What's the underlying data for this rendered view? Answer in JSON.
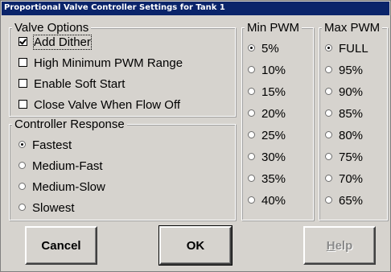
{
  "window": {
    "title": "Proportional Valve Controller Settings for Tank 1"
  },
  "valve_options": {
    "legend": "Valve Options",
    "items": [
      {
        "label": "Add Dither",
        "checked": true
      },
      {
        "label": "High Minimum PWM Range",
        "checked": false
      },
      {
        "label": "Enable Soft Start",
        "checked": false
      },
      {
        "label": "Close Valve When Flow Off",
        "checked": false
      }
    ]
  },
  "controller_response": {
    "legend": "Controller Response",
    "options": [
      {
        "label": "Fastest",
        "selected": true
      },
      {
        "label": "Medium-Fast",
        "selected": false
      },
      {
        "label": "Medium-Slow",
        "selected": false
      },
      {
        "label": "Slowest",
        "selected": false
      }
    ]
  },
  "min_pwm": {
    "legend": "Min PWM",
    "options": [
      {
        "label": "5%",
        "selected": true
      },
      {
        "label": "10%",
        "selected": false
      },
      {
        "label": "15%",
        "selected": false
      },
      {
        "label": "20%",
        "selected": false
      },
      {
        "label": "25%",
        "selected": false
      },
      {
        "label": "30%",
        "selected": false
      },
      {
        "label": "35%",
        "selected": false
      },
      {
        "label": "40%",
        "selected": false
      }
    ]
  },
  "max_pwm": {
    "legend": "Max PWM",
    "options": [
      {
        "label": "FULL",
        "selected": true
      },
      {
        "label": "95%",
        "selected": false
      },
      {
        "label": "90%",
        "selected": false
      },
      {
        "label": "85%",
        "selected": false
      },
      {
        "label": "80%",
        "selected": false
      },
      {
        "label": "75%",
        "selected": false
      },
      {
        "label": "70%",
        "selected": false
      },
      {
        "label": "65%",
        "selected": false
      }
    ]
  },
  "buttons": {
    "cancel": "Cancel",
    "ok": "OK",
    "help_prefix": "H",
    "help_rest": "elp"
  }
}
